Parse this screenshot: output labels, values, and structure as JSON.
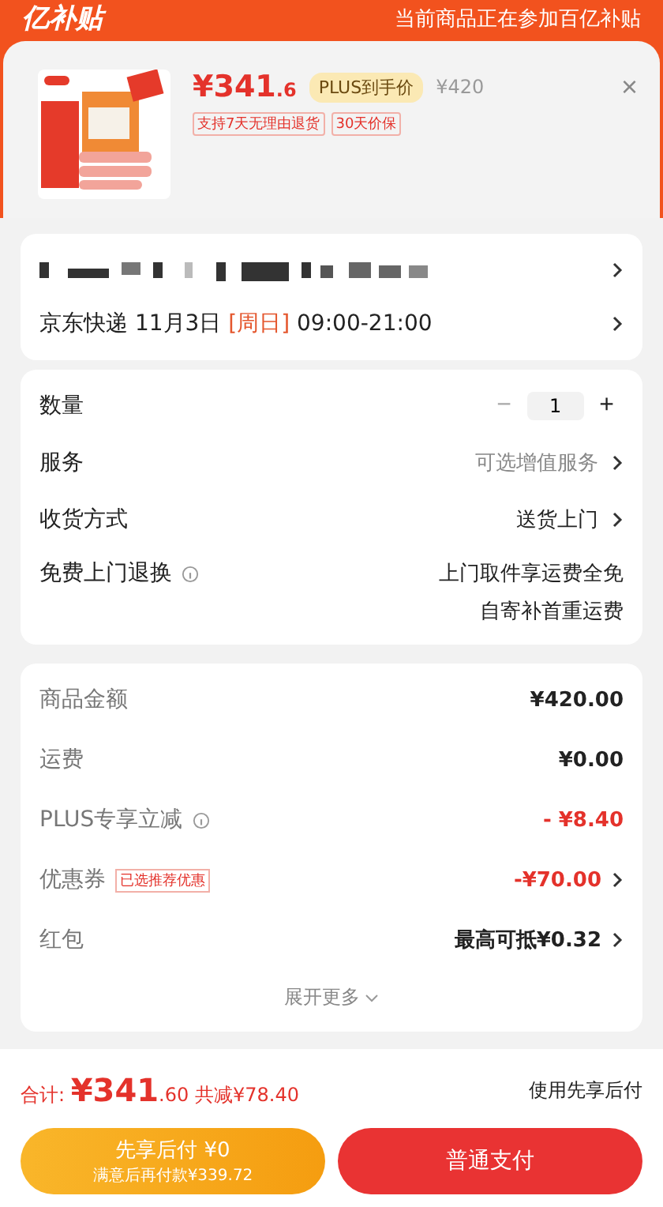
{
  "header": {
    "logo": "亿补贴",
    "notice": "当前商品正在参加百亿补贴"
  },
  "product": {
    "price_main": "¥341",
    "price_decimal": ".6",
    "plus_badge": "PLUS到手价",
    "original_price": "¥420",
    "close": "×",
    "tags": [
      "支持7天无理由退货",
      "30天价保"
    ]
  },
  "delivery": {
    "carrier": "京东快递 11月3日",
    "weekday": "[周日]",
    "time": "09:00-21:00"
  },
  "options": [
    {
      "kind": "stepper",
      "label": "数量",
      "minus": "−",
      "value": "1",
      "plus": "+"
    },
    {
      "kind": "link",
      "label": "服务",
      "value": "可选增值服务",
      "muted": true
    },
    {
      "kind": "link",
      "label": "收货方式",
      "value": "送货上门",
      "muted": false
    },
    {
      "kind": "info",
      "label": "免费上门退换",
      "lines": [
        "上门取件享运费全免",
        "自寄补首重运费"
      ]
    }
  ],
  "costs": [
    {
      "label": "商品金额",
      "value": "¥420.00",
      "red": false,
      "info": false,
      "arrow": false
    },
    {
      "label": "运费",
      "value": "¥0.00",
      "red": false,
      "info": false,
      "arrow": false
    },
    {
      "label": "PLUS专享立减",
      "value": "- ¥8.40",
      "red": true,
      "info": true,
      "arrow": false
    },
    {
      "label": "优惠券",
      "tag": "已选推荐优惠",
      "value": "-¥70.00",
      "red": true,
      "info": false,
      "arrow": true
    },
    {
      "label": "红包",
      "value": "最高可抵¥0.32",
      "red": false,
      "info": false,
      "arrow": true
    }
  ],
  "expand": "展开更多",
  "footer": {
    "total_label": "合计:",
    "total_main": "¥341",
    "total_decimal": ".60",
    "saved": "共减¥78.40",
    "note": "使用先享后付",
    "pay_later": {
      "title": "先享后付 ¥0",
      "sub": "满意后再付款¥339.72"
    },
    "pay_now": "普通支付"
  }
}
